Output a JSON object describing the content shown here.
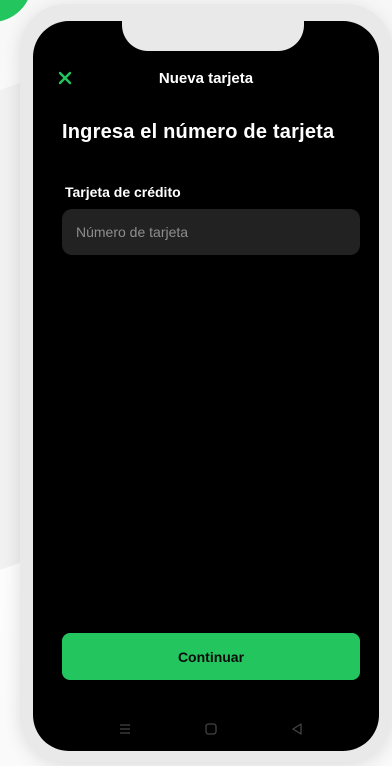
{
  "header": {
    "close_icon": "close-icon",
    "title": "Nueva tarjeta"
  },
  "main": {
    "page_title": "Ingresa el número de tarjeta",
    "card_field": {
      "label": "Tarjeta de crédito",
      "value": "",
      "placeholder": "Número de tarjeta"
    },
    "continue_label": "Continuar"
  },
  "system_nav": {
    "icons": [
      "menu-icon",
      "home-icon",
      "back-icon"
    ]
  },
  "colors": {
    "accent": "#22c55e",
    "screen_background": "#000000",
    "input_background": "#222222"
  }
}
